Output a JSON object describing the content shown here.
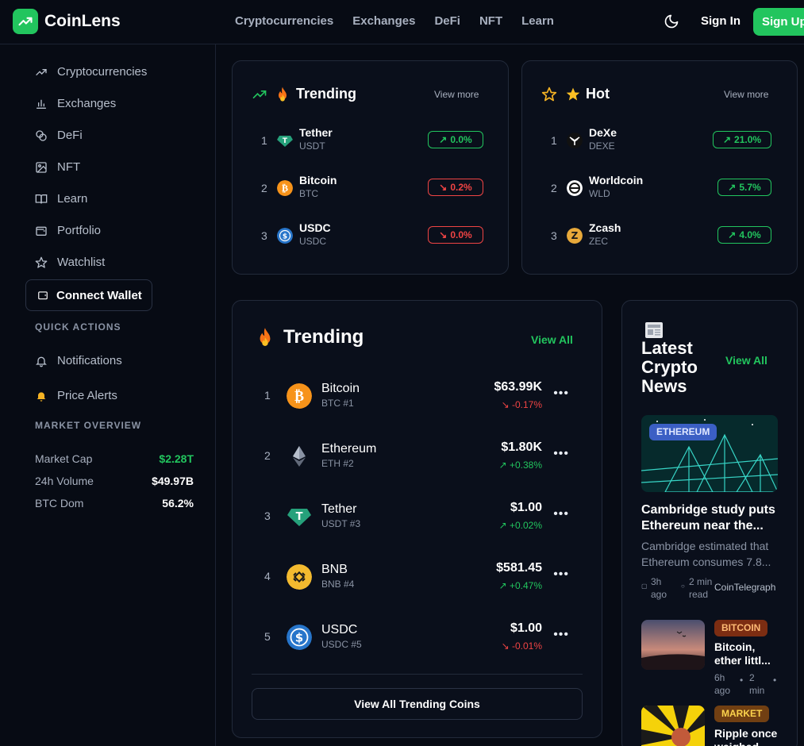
{
  "brand": {
    "name": "CoinLens",
    "color": "#22c55e"
  },
  "topnav": [
    "Cryptocurrencies",
    "Exchanges",
    "DeFi",
    "NFT",
    "Learn"
  ],
  "header": {
    "sign_in": "Sign In",
    "sign_up": "Sign Up"
  },
  "sidebar": {
    "items": [
      {
        "label": "Cryptocurrencies",
        "icon": "trending-up-icon"
      },
      {
        "label": "Exchanges",
        "icon": "bar-chart-icon"
      },
      {
        "label": "DeFi",
        "icon": "coins-icon"
      },
      {
        "label": "NFT",
        "icon": "image-icon"
      },
      {
        "label": "Learn",
        "icon": "book-icon"
      },
      {
        "label": "Portfolio",
        "icon": "wallet-icon"
      },
      {
        "label": "Watchlist",
        "icon": "star-icon"
      }
    ],
    "connect_wallet": "Connect Wallet",
    "quick_actions_title": "QUICK ACTIONS",
    "quick_actions": [
      {
        "label": "Notifications",
        "icon": "bell-icon"
      },
      {
        "label": "Price Alerts",
        "icon": "bell-filled-icon"
      }
    ],
    "market_overview_title": "MARKET OVERVIEW",
    "market": [
      {
        "key": "Market Cap",
        "value": "$2.28T",
        "color": "#22c55e"
      },
      {
        "key": "24h Volume",
        "value": "$49.97B",
        "color": "#ffffff"
      },
      {
        "key": "BTC Dom",
        "value": "56.2%",
        "color": "#ffffff"
      }
    ]
  },
  "trending_small": {
    "title": "Trending",
    "view_more": "View more",
    "rows": [
      {
        "rank": "1",
        "name": "Tether",
        "symbol": "USDT",
        "change": "0.0%",
        "dir": "up",
        "icon_color": "#26a17b"
      },
      {
        "rank": "2",
        "name": "Bitcoin",
        "symbol": "BTC",
        "change": "0.2%",
        "dir": "down",
        "icon_color": "#f7931a"
      },
      {
        "rank": "3",
        "name": "USDC",
        "symbol": "USDC",
        "change": "0.0%",
        "dir": "down",
        "icon_color": "#2775ca"
      }
    ]
  },
  "hot": {
    "title": "Hot",
    "view_more": "View more",
    "rows": [
      {
        "rank": "1",
        "name": "DeXe",
        "symbol": "DEXE",
        "change": "21.0%",
        "dir": "up",
        "icon_color": "#111111"
      },
      {
        "rank": "2",
        "name": "Worldcoin",
        "symbol": "WLD",
        "change": "5.7%",
        "dir": "up",
        "icon_color": "#ffffff"
      },
      {
        "rank": "3",
        "name": "Zcash",
        "symbol": "ZEC",
        "change": "4.0%",
        "dir": "up",
        "icon_color": "#e8a93a"
      }
    ]
  },
  "trending_big": {
    "title": "Trending",
    "view_all": "View All",
    "rows": [
      {
        "rank": "1",
        "name": "Bitcoin",
        "symbol": "BTC #1",
        "price": "$63.99K",
        "change": "-0.17%",
        "dir": "down",
        "icon_color": "#f7931a"
      },
      {
        "rank": "2",
        "name": "Ethereum",
        "symbol": "ETH #2",
        "price": "$1.80K",
        "change": "+0.38%",
        "dir": "up",
        "icon_color": "#0a0f1b"
      },
      {
        "rank": "3",
        "name": "Tether",
        "symbol": "USDT #3",
        "price": "$1.00",
        "change": "+0.02%",
        "dir": "up",
        "icon_color": "#26a17b"
      },
      {
        "rank": "4",
        "name": "BNB",
        "symbol": "BNB #4",
        "price": "$581.45",
        "change": "+0.47%",
        "dir": "up",
        "icon_color": "#f3ba2f"
      },
      {
        "rank": "5",
        "name": "USDC",
        "symbol": "USDC #5",
        "price": "$1.00",
        "change": "-0.01%",
        "dir": "down",
        "icon_color": "#2775ca"
      }
    ],
    "footer_button": "View All Trending Coins"
  },
  "news": {
    "title": "Latest Crypto News",
    "view_all": "View All",
    "featured": {
      "tag": "ETHEREUM",
      "headline": "Cambridge study puts Ethereum near the...",
      "summary": "Cambridge estimated that Ethereum consumes 7.8...",
      "time": "3h ago",
      "read": "2 min read",
      "source": "CoinTelegraph"
    },
    "items": [
      {
        "tag": "BITCOIN",
        "headline": "Bitcoin, ether littl...",
        "time": "6h ago",
        "read": "2 min"
      },
      {
        "tag": "MARKET",
        "headline": "Ripple once weighed..."
      }
    ]
  }
}
